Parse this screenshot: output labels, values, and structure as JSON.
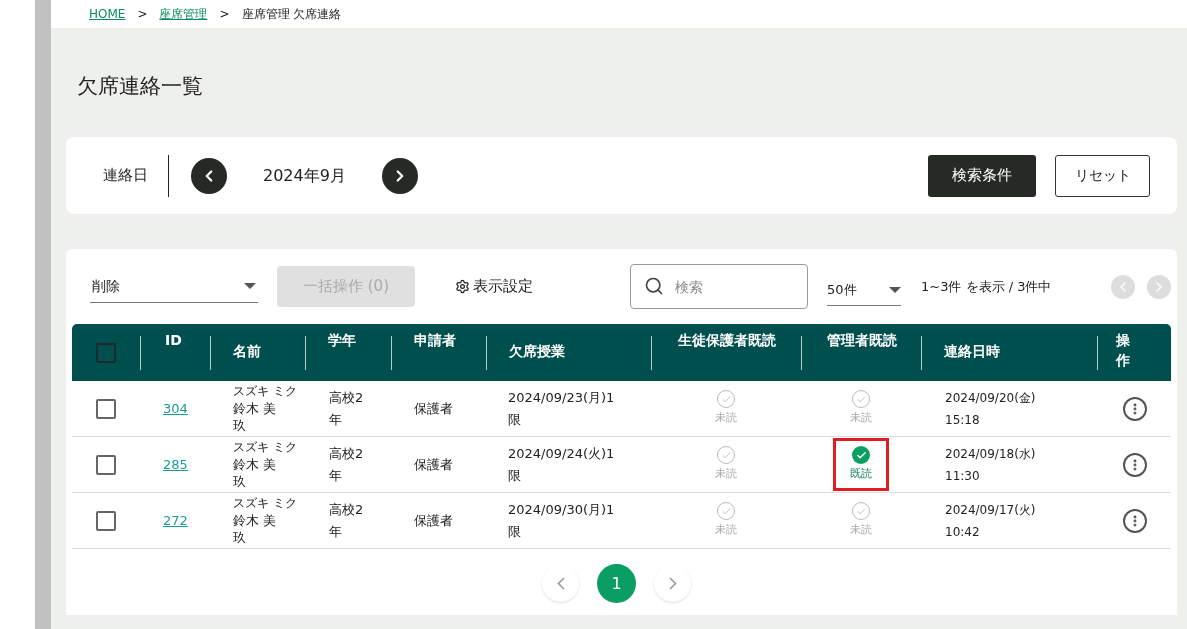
{
  "breadcrumb": [
    {
      "label": "HOME",
      "link": true
    },
    {
      "label": "座席管理",
      "link": true
    },
    {
      "label": "座席管理 欠席連絡",
      "link": false
    }
  ],
  "breadcrumb_separator": ">",
  "page_title": "欠席連絡一覧",
  "filter": {
    "label": "連絡日",
    "month": "2024年9月",
    "search_button": "検索条件",
    "reset_button": "リセット"
  },
  "toolbar": {
    "action_select": "削除",
    "bulk_button": "一括操作 (0)",
    "bulk_disabled": true,
    "display_settings": "表示設定",
    "search": {
      "placeholder": "検索"
    },
    "per_page": "50件",
    "range": "1~3件 を表示 / 3件中"
  },
  "table": {
    "columns": [
      "ID",
      "名前",
      "学年",
      "申請者",
      "欠席授業",
      "生徒保護者既読",
      "管理者既読",
      "連絡日時",
      "操作"
    ],
    "header_checked": false,
    "rows": [
      {
        "checked": false,
        "id": "304",
        "kana": "スズキ ミク",
        "name": "鈴木 美玖",
        "grade": "高校2年",
        "applicant": "保護者",
        "class": "2024/09/23(月)1限",
        "guardian_read": {
          "read": false,
          "label": "未読",
          "highlighted": false
        },
        "admin_read": {
          "read": false,
          "label": "未読",
          "highlighted": false
        },
        "date": "2024/09/20(金)",
        "time": "15:18"
      },
      {
        "checked": false,
        "id": "285",
        "kana": "スズキ ミク",
        "name": "鈴木 美玖",
        "grade": "高校2年",
        "applicant": "保護者",
        "class": "2024/09/24(火)1限",
        "guardian_read": {
          "read": false,
          "label": "未読",
          "highlighted": false
        },
        "admin_read": {
          "read": true,
          "label": "既読",
          "highlighted": true
        },
        "date": "2024/09/18(水)",
        "time": "11:30"
      },
      {
        "checked": false,
        "id": "272",
        "kana": "スズキ ミク",
        "name": "鈴木 美玖",
        "grade": "高校2年",
        "applicant": "保護者",
        "class": "2024/09/30(月)1限",
        "guardian_read": {
          "read": false,
          "label": "未読",
          "highlighted": false
        },
        "admin_read": {
          "read": false,
          "label": "未読",
          "highlighted": false
        },
        "date": "2024/09/17(火)",
        "time": "10:42"
      }
    ]
  },
  "pagination": [
    {
      "label": "1",
      "selected": true
    }
  ]
}
